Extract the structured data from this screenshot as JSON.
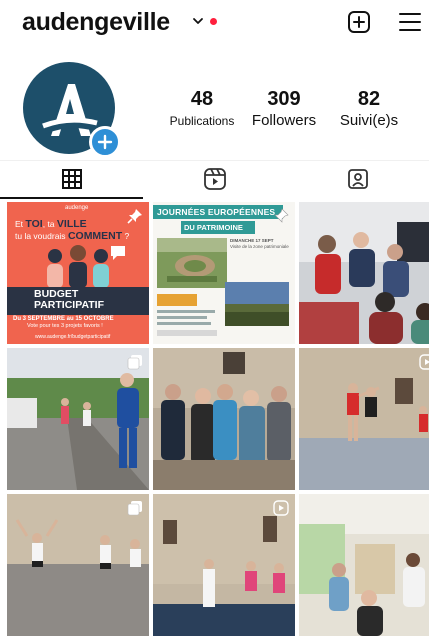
{
  "header": {
    "username": "audengeville",
    "dropdown_icon": "chevron-down-icon",
    "notification_dot_color": "#ff1f3d",
    "create_icon": "plus-square-icon",
    "menu_icon": "hamburger-menu-icon"
  },
  "profile": {
    "avatar_letter": "A",
    "avatar_color": "#1d4f6a",
    "add_story_color": "#2e8fd6"
  },
  "stats": {
    "posts_count": "48",
    "posts_label": "Publications",
    "followers_count": "309",
    "followers_label": "Followers",
    "following_count": "82",
    "following_label": "Suivi(e)s"
  },
  "tabs": [
    {
      "name": "grid",
      "icon": "grid-icon",
      "active": true
    },
    {
      "name": "reels",
      "icon": "reels-icon",
      "active": false
    },
    {
      "name": "tagged",
      "icon": "tagged-user-icon",
      "active": false
    }
  ],
  "posts": {
    "p1": {
      "brand": "audenge",
      "line1_prefix": "Et",
      "line1_toi": "TOI",
      "line1_ta": ", ta",
      "line1_ville": "VILLE",
      "line2_prefix": "tu la voudrais",
      "line2_comment": "COMMENT",
      "line2_suffix": " ?",
      "title_line1": "BUDGET",
      "title_line2": "PARTICIPATIF",
      "dates": "Du 3 SEPTEMBRE au 15 OCTOBRE",
      "vote": "Vote pour tes 3 projets favoris !",
      "url": "www.audenge.fr/budgetparticipatif"
    },
    "p2": {
      "title_line1": "JOURNÉES EUROPÉENNES",
      "title_line2": "DU PATRIMOINE",
      "date_line": "DIMANCHE 17 SEPT",
      "details": "Visite de la zone patrimoniale"
    }
  }
}
